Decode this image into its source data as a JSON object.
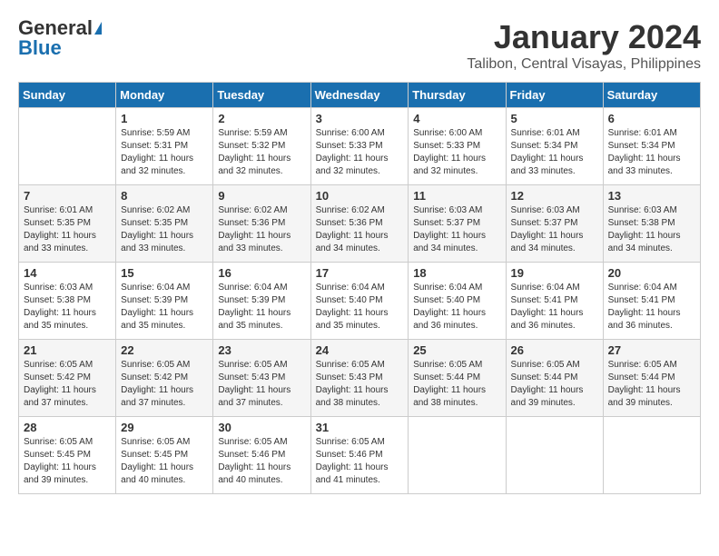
{
  "header": {
    "logo_general": "General",
    "logo_blue": "Blue",
    "month_title": "January 2024",
    "location": "Talibon, Central Visayas, Philippines"
  },
  "weekdays": [
    "Sunday",
    "Monday",
    "Tuesday",
    "Wednesday",
    "Thursday",
    "Friday",
    "Saturday"
  ],
  "weeks": [
    [
      {
        "day": "",
        "sunrise": "",
        "sunset": "",
        "daylight": ""
      },
      {
        "day": "1",
        "sunrise": "Sunrise: 5:59 AM",
        "sunset": "Sunset: 5:31 PM",
        "daylight": "Daylight: 11 hours and 32 minutes."
      },
      {
        "day": "2",
        "sunrise": "Sunrise: 5:59 AM",
        "sunset": "Sunset: 5:32 PM",
        "daylight": "Daylight: 11 hours and 32 minutes."
      },
      {
        "day": "3",
        "sunrise": "Sunrise: 6:00 AM",
        "sunset": "Sunset: 5:33 PM",
        "daylight": "Daylight: 11 hours and 32 minutes."
      },
      {
        "day": "4",
        "sunrise": "Sunrise: 6:00 AM",
        "sunset": "Sunset: 5:33 PM",
        "daylight": "Daylight: 11 hours and 32 minutes."
      },
      {
        "day": "5",
        "sunrise": "Sunrise: 6:01 AM",
        "sunset": "Sunset: 5:34 PM",
        "daylight": "Daylight: 11 hours and 33 minutes."
      },
      {
        "day": "6",
        "sunrise": "Sunrise: 6:01 AM",
        "sunset": "Sunset: 5:34 PM",
        "daylight": "Daylight: 11 hours and 33 minutes."
      }
    ],
    [
      {
        "day": "7",
        "sunrise": "Sunrise: 6:01 AM",
        "sunset": "Sunset: 5:35 PM",
        "daylight": "Daylight: 11 hours and 33 minutes."
      },
      {
        "day": "8",
        "sunrise": "Sunrise: 6:02 AM",
        "sunset": "Sunset: 5:35 PM",
        "daylight": "Daylight: 11 hours and 33 minutes."
      },
      {
        "day": "9",
        "sunrise": "Sunrise: 6:02 AM",
        "sunset": "Sunset: 5:36 PM",
        "daylight": "Daylight: 11 hours and 33 minutes."
      },
      {
        "day": "10",
        "sunrise": "Sunrise: 6:02 AM",
        "sunset": "Sunset: 5:36 PM",
        "daylight": "Daylight: 11 hours and 34 minutes."
      },
      {
        "day": "11",
        "sunrise": "Sunrise: 6:03 AM",
        "sunset": "Sunset: 5:37 PM",
        "daylight": "Daylight: 11 hours and 34 minutes."
      },
      {
        "day": "12",
        "sunrise": "Sunrise: 6:03 AM",
        "sunset": "Sunset: 5:37 PM",
        "daylight": "Daylight: 11 hours and 34 minutes."
      },
      {
        "day": "13",
        "sunrise": "Sunrise: 6:03 AM",
        "sunset": "Sunset: 5:38 PM",
        "daylight": "Daylight: 11 hours and 34 minutes."
      }
    ],
    [
      {
        "day": "14",
        "sunrise": "Sunrise: 6:03 AM",
        "sunset": "Sunset: 5:38 PM",
        "daylight": "Daylight: 11 hours and 35 minutes."
      },
      {
        "day": "15",
        "sunrise": "Sunrise: 6:04 AM",
        "sunset": "Sunset: 5:39 PM",
        "daylight": "Daylight: 11 hours and 35 minutes."
      },
      {
        "day": "16",
        "sunrise": "Sunrise: 6:04 AM",
        "sunset": "Sunset: 5:39 PM",
        "daylight": "Daylight: 11 hours and 35 minutes."
      },
      {
        "day": "17",
        "sunrise": "Sunrise: 6:04 AM",
        "sunset": "Sunset: 5:40 PM",
        "daylight": "Daylight: 11 hours and 35 minutes."
      },
      {
        "day": "18",
        "sunrise": "Sunrise: 6:04 AM",
        "sunset": "Sunset: 5:40 PM",
        "daylight": "Daylight: 11 hours and 36 minutes."
      },
      {
        "day": "19",
        "sunrise": "Sunrise: 6:04 AM",
        "sunset": "Sunset: 5:41 PM",
        "daylight": "Daylight: 11 hours and 36 minutes."
      },
      {
        "day": "20",
        "sunrise": "Sunrise: 6:04 AM",
        "sunset": "Sunset: 5:41 PM",
        "daylight": "Daylight: 11 hours and 36 minutes."
      }
    ],
    [
      {
        "day": "21",
        "sunrise": "Sunrise: 6:05 AM",
        "sunset": "Sunset: 5:42 PM",
        "daylight": "Daylight: 11 hours and 37 minutes."
      },
      {
        "day": "22",
        "sunrise": "Sunrise: 6:05 AM",
        "sunset": "Sunset: 5:42 PM",
        "daylight": "Daylight: 11 hours and 37 minutes."
      },
      {
        "day": "23",
        "sunrise": "Sunrise: 6:05 AM",
        "sunset": "Sunset: 5:43 PM",
        "daylight": "Daylight: 11 hours and 37 minutes."
      },
      {
        "day": "24",
        "sunrise": "Sunrise: 6:05 AM",
        "sunset": "Sunset: 5:43 PM",
        "daylight": "Daylight: 11 hours and 38 minutes."
      },
      {
        "day": "25",
        "sunrise": "Sunrise: 6:05 AM",
        "sunset": "Sunset: 5:44 PM",
        "daylight": "Daylight: 11 hours and 38 minutes."
      },
      {
        "day": "26",
        "sunrise": "Sunrise: 6:05 AM",
        "sunset": "Sunset: 5:44 PM",
        "daylight": "Daylight: 11 hours and 39 minutes."
      },
      {
        "day": "27",
        "sunrise": "Sunrise: 6:05 AM",
        "sunset": "Sunset: 5:44 PM",
        "daylight": "Daylight: 11 hours and 39 minutes."
      }
    ],
    [
      {
        "day": "28",
        "sunrise": "Sunrise: 6:05 AM",
        "sunset": "Sunset: 5:45 PM",
        "daylight": "Daylight: 11 hours and 39 minutes."
      },
      {
        "day": "29",
        "sunrise": "Sunrise: 6:05 AM",
        "sunset": "Sunset: 5:45 PM",
        "daylight": "Daylight: 11 hours and 40 minutes."
      },
      {
        "day": "30",
        "sunrise": "Sunrise: 6:05 AM",
        "sunset": "Sunset: 5:46 PM",
        "daylight": "Daylight: 11 hours and 40 minutes."
      },
      {
        "day": "31",
        "sunrise": "Sunrise: 6:05 AM",
        "sunset": "Sunset: 5:46 PM",
        "daylight": "Daylight: 11 hours and 41 minutes."
      },
      {
        "day": "",
        "sunrise": "",
        "sunset": "",
        "daylight": ""
      },
      {
        "day": "",
        "sunrise": "",
        "sunset": "",
        "daylight": ""
      },
      {
        "day": "",
        "sunrise": "",
        "sunset": "",
        "daylight": ""
      }
    ]
  ]
}
